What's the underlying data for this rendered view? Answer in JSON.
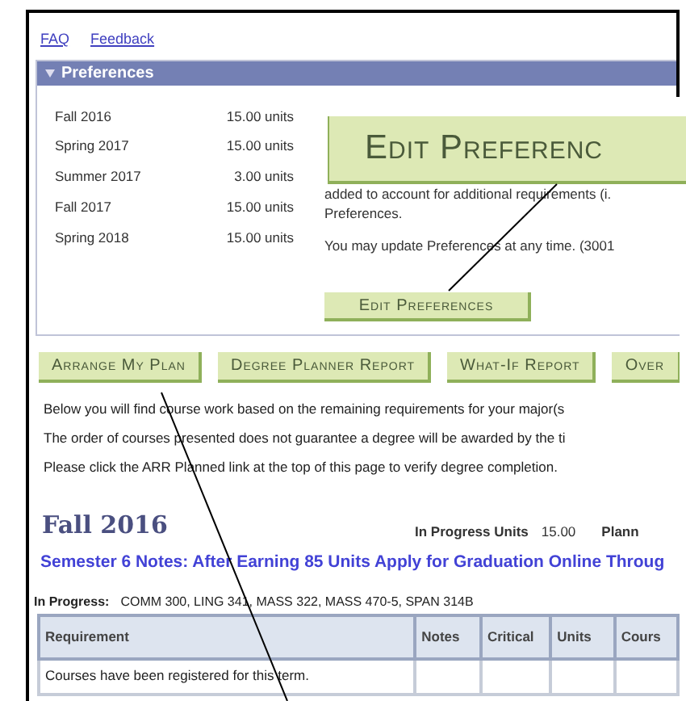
{
  "links": [
    {
      "label": "FAQ"
    },
    {
      "label": "Feedback"
    }
  ],
  "preferences": {
    "title": "Preferences",
    "expanded": true,
    "terms": [
      {
        "term": "Fall 2016",
        "units": "15.00 units"
      },
      {
        "term": "Spring 2017",
        "units": "15.00 units"
      },
      {
        "term": "Summer 2017",
        "units": "3.00 units"
      },
      {
        "term": "Fall 2017",
        "units": "15.00 units"
      },
      {
        "term": "Spring 2018",
        "units": "15.00 units"
      }
    ],
    "text": "added to account for additional requirements (i.",
    "text_end": "Preferences.",
    "update_note": "You may update Preferences at any time. (3001",
    "edit_button": "Edit Preferences"
  },
  "callout": {
    "text": "Edit Preferenc"
  },
  "actions": [
    "Arrange My Plan",
    "Degree Planner Report",
    "What-If Report",
    "Over"
  ],
  "notes": [
    "Below you will find course work based on the remaining requirements for your major(s",
    "The order of courses presented does not guarantee a degree will be awarded by the ti",
    "Please click the ARR Planned link at the top of this page to verify degree completion."
  ],
  "term": {
    "title": "Fall 2016",
    "in_progress_units_label": "In Progress Units",
    "in_progress_units": "15.00",
    "planned_label": "Plann",
    "semester_note": "Semester 6 Notes: After Earning 85 Units Apply for Graduation Online Throug",
    "in_progress_label": "In Progress:",
    "in_progress_courses": "COMM 300, LING 341, MASS 322, MASS 470-5, SPAN 314B"
  },
  "table": {
    "columns": [
      "Requirement",
      "Notes",
      "Critical",
      "Units",
      "Cours"
    ],
    "rows": [
      {
        "requirement": "Courses have been registered for this term."
      }
    ]
  }
}
